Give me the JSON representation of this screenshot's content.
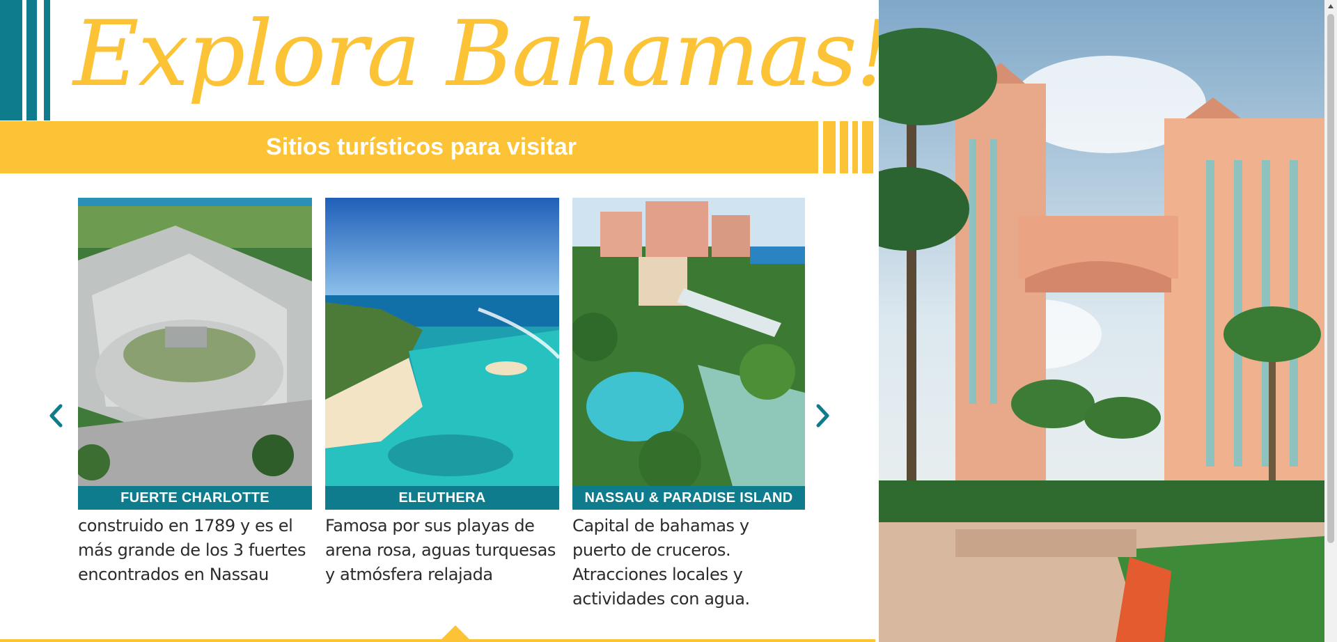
{
  "header": {
    "title": "Explora Bahamas!",
    "banner": "Sitios turísticos para visitar"
  },
  "carousel": {
    "prev_icon": "chevron-left-icon",
    "next_icon": "chevron-right-icon",
    "cards": [
      {
        "label": "FUERTE CHARLOTTE",
        "description": "construido en 1789 y es el más grande de los 3 fuertes encontrados en Nassau",
        "image": "fort-aerial-photo"
      },
      {
        "label": "ELEUTHERA",
        "description": "Famosa por sus playas de arena rosa, aguas turquesas y atmósfera relajada",
        "image": "turquoise-coast-photo"
      },
      {
        "label": "NASSAU & PARADISE ISLAND",
        "description": "Capital de bahamas y puerto de cruceros. Atracciones locales y actividades con agua.",
        "image": "resort-waterpark-photo"
      }
    ]
  },
  "hero_image": "atlantis-resort-photo",
  "colors": {
    "accent_yellow": "#fdc336",
    "accent_teal": "#0e7c8c",
    "text_dark": "#2b2b2b"
  }
}
